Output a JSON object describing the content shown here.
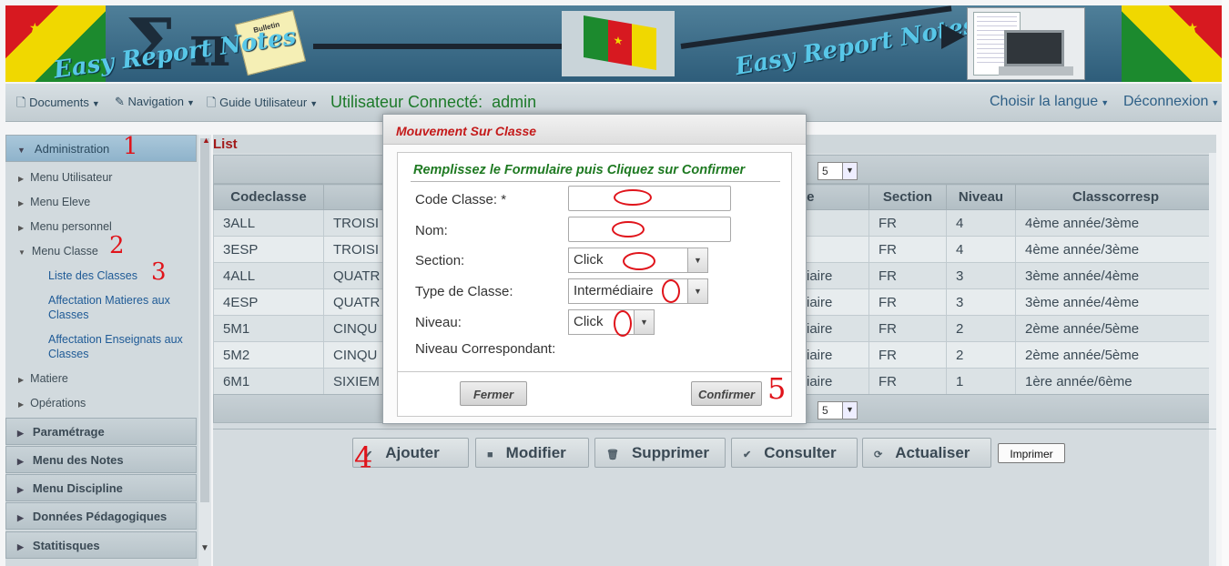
{
  "banner": {
    "text_left": "Easy Report Notes",
    "text_right": "Easy Report Notes",
    "note_label": "Bulletin"
  },
  "menubar": {
    "items": [
      {
        "label": "Documents",
        "icon": "document-icon"
      },
      {
        "label": "Navigation",
        "icon": "pencil-icon"
      },
      {
        "label": "Guide Utilisateur",
        "icon": "document-icon"
      }
    ],
    "user_label": "Utilisateur Connecté:",
    "user_name": "admin",
    "language": "Choisir la langue",
    "logout": "Déconnexion"
  },
  "sidebar": {
    "sections": [
      {
        "label": "Administration"
      },
      {
        "label": "Paramétrage"
      },
      {
        "label": "Menu des Notes"
      },
      {
        "label": "Menu Discipline"
      },
      {
        "label": "Données Pédagogiques"
      },
      {
        "label": "Statitisques"
      }
    ],
    "sub_items": [
      {
        "label": "Menu Utilisateur"
      },
      {
        "label": "Menu Eleve"
      },
      {
        "label": "Menu personnel"
      },
      {
        "label": "Menu Classe"
      },
      {
        "label": "Matiere"
      },
      {
        "label": "Opérations"
      }
    ],
    "links": [
      {
        "label": "Liste des Classes"
      },
      {
        "label": "Affectation Matieres aux Classes"
      },
      {
        "label": "Affectation Enseignats aux Classes"
      }
    ]
  },
  "list": {
    "title": "List",
    "rows_per_page": "5",
    "columns": [
      "Codeclasse",
      "",
      "pe",
      "Section",
      "Niveau",
      "Classcorresp"
    ],
    "rows": [
      {
        "code": "3ALL",
        "nom": "TROISI",
        "type": "",
        "section": "FR",
        "niveau": "4",
        "corresp": "4ème année/3ème"
      },
      {
        "code": "3ESP",
        "nom": "TROISI",
        "type": "",
        "section": "FR",
        "niveau": "4",
        "corresp": "4ème année/3ème"
      },
      {
        "code": "4ALL",
        "nom": "QUATR",
        "type": "iaire",
        "section": "FR",
        "niveau": "3",
        "corresp": "3ème année/4ème"
      },
      {
        "code": "4ESP",
        "nom": "QUATR",
        "type": "iaire",
        "section": "FR",
        "niveau": "3",
        "corresp": "3ème année/4ème"
      },
      {
        "code": "5M1",
        "nom": "CINQU",
        "type": "iaire",
        "section": "FR",
        "niveau": "2",
        "corresp": "2ème année/5ème"
      },
      {
        "code": "5M2",
        "nom": "CINQU",
        "type": "iaire",
        "section": "FR",
        "niveau": "2",
        "corresp": "2ème année/5ème"
      },
      {
        "code": "6M1",
        "nom": "SIXIEM",
        "type": "iaire",
        "section": "FR",
        "niveau": "1",
        "corresp": "1ère année/6ème"
      }
    ]
  },
  "actions": {
    "add": "Ajouter",
    "edit": "Modifier",
    "delete": "Supprimer",
    "view": "Consulter",
    "refresh": "Actualiser",
    "print": "Imprimer"
  },
  "modal": {
    "title": "Mouvement Sur Classe",
    "form_title": "Remplissez le Formulaire puis Cliquez sur Confirmer",
    "fields": {
      "code_label": "Code Classe: *",
      "code_value": "",
      "nom_label": "Nom:",
      "nom_value": "",
      "section_label": "Section:",
      "section_value": "Click",
      "type_label": "Type de Classe:",
      "type_value": "Intermédiaire",
      "niveau_label": "Niveau:",
      "niveau_value": "Click",
      "niveau_corresp_label": "Niveau Correspondant:"
    },
    "close": "Fermer",
    "confirm": "Confirmer"
  },
  "annotations": [
    "1",
    "2",
    "3",
    "4",
    "5"
  ],
  "colors": {
    "annotation_red": "#e0141b",
    "form_title_green": "#1f7a22",
    "modal_title_red": "#c41a1a",
    "list_title_red": "#a21a1a",
    "flag_green": "#1c8a2e",
    "flag_red": "#d71920",
    "flag_yellow": "#f0d800"
  }
}
